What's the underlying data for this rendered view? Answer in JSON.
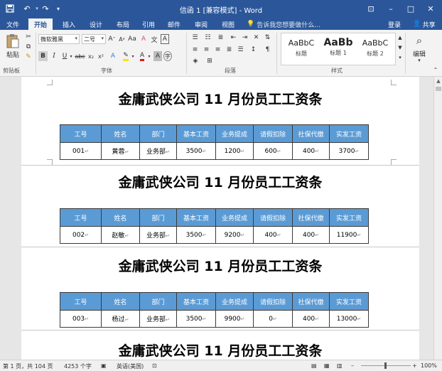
{
  "titlebar": {
    "title": "信函 1 [兼容模式] - Word",
    "minimize": "–",
    "maximize": "□",
    "close": "✕",
    "restore_ribbon": "⊡"
  },
  "tabs": [
    {
      "label": "文件"
    },
    {
      "label": "开始"
    },
    {
      "label": "插入"
    },
    {
      "label": "设计"
    },
    {
      "label": "布局"
    },
    {
      "label": "引用"
    },
    {
      "label": "邮件"
    },
    {
      "label": "审阅"
    },
    {
      "label": "视图"
    }
  ],
  "tell_me": "告诉我您想要做什么...",
  "account": {
    "login": "登录",
    "share": "共享"
  },
  "ribbon": {
    "paste_label": "粘贴",
    "clipboard_label": "剪贴板",
    "font_name": "微软雅黑",
    "font_size": "二号",
    "font_label": "字体",
    "paragraph_label": "段落",
    "styles_label": "样式",
    "edit_label": "编辑",
    "styles": [
      {
        "preview": "AaBbC",
        "name": "标题"
      },
      {
        "preview": "AaBb",
        "name": "标题 1"
      },
      {
        "preview": "AaBbC",
        "name": "标题 2"
      }
    ]
  },
  "document": {
    "title": "金庸武侠公司 11 月份员工工资条",
    "headers": [
      "工号",
      "姓名",
      "部门",
      "基本工资",
      "业务提成",
      "请假扣除",
      "社保代缴",
      "实发工资"
    ],
    "rows": [
      [
        "001",
        "黄蓉",
        "业务部",
        "3500",
        "1200",
        "600",
        "400",
        "3700"
      ],
      [
        "002",
        "赵敏",
        "业务部",
        "3500",
        "9200",
        "400",
        "400",
        "11900"
      ],
      [
        "003",
        "杨过",
        "业务部",
        "3500",
        "9900",
        "0",
        "400",
        "13000"
      ]
    ]
  },
  "status": {
    "page": "第 1 页，共 104 页",
    "words": "4253 个字",
    "language": "英语(美国)",
    "zoom": "100%"
  },
  "colors": {
    "brand": "#2b579a",
    "table_header": "#5b9bd5"
  }
}
